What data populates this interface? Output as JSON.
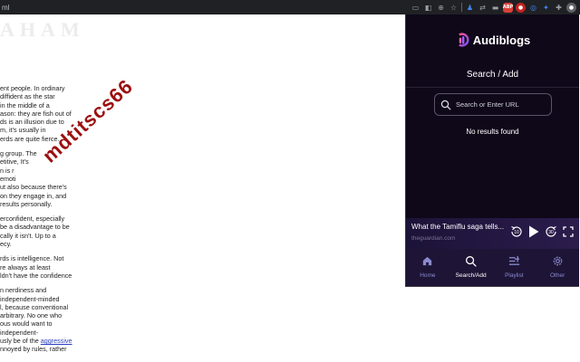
{
  "browser": {
    "url_fragment": "ml",
    "toolbar_icons": [
      "cast-icon",
      "reader-icon",
      "zoom-icon",
      "bookmark-star-icon",
      "extension-icon",
      "extension-icon",
      "extension-icon",
      "adblock-icon",
      "extension-icon",
      "extension-icon",
      "extension-icon",
      "puzzle-icon",
      "profile-avatar"
    ],
    "adblock_label": "ABP"
  },
  "article": {
    "site_title": "AHAM",
    "paragraphs": [
      "ent people. In ordinary\ndiffident as the star\nin the middle of a\nason: they are fish out of\nds is an illusion due to\nm, it's usually in\nerds are quite fierce.",
      "g group. The\netitive, It's\nn is r\nemoti\nut also because there's\non they engage in, and\nresults personally.",
      "erconfident, especially\nbe a disadvantage to be\ncally it isn't. Up to a\necy.",
      "rds is intelligence. Not\nre always at least\nldn't have the confidence",
      "n nerdiness and\nindependent-minded\nl, because conventional\narbitrary. No one who\nous would want to\nindependent-\nusly be of the"
    ],
    "link_text": "aggressive",
    "last_line": "nnoyed by rules, rather",
    "watermark": "mdtitscs66"
  },
  "popup": {
    "brand_name": "Audiblogs",
    "heading": "Search / Add",
    "search_placeholder": "Search or Enter URL",
    "search_value": "",
    "empty_message": "No results found",
    "colors": {
      "background": "#0f0819",
      "accent": "#b24bd9",
      "nav_bg": "#1e1536",
      "nav_label": "#8a8ad0"
    },
    "player": {
      "title": "What the Tamiflu saga tells...",
      "source": "theguardian.com",
      "skip_back": "10",
      "skip_forward": "30"
    },
    "nav": [
      {
        "label": "Home",
        "icon": "home-icon",
        "active": false
      },
      {
        "label": "Search/Add",
        "icon": "search-icon",
        "active": true
      },
      {
        "label": "Playlist",
        "icon": "playlist-icon",
        "active": false
      },
      {
        "label": "Other",
        "icon": "gear-icon",
        "active": false
      }
    ]
  }
}
